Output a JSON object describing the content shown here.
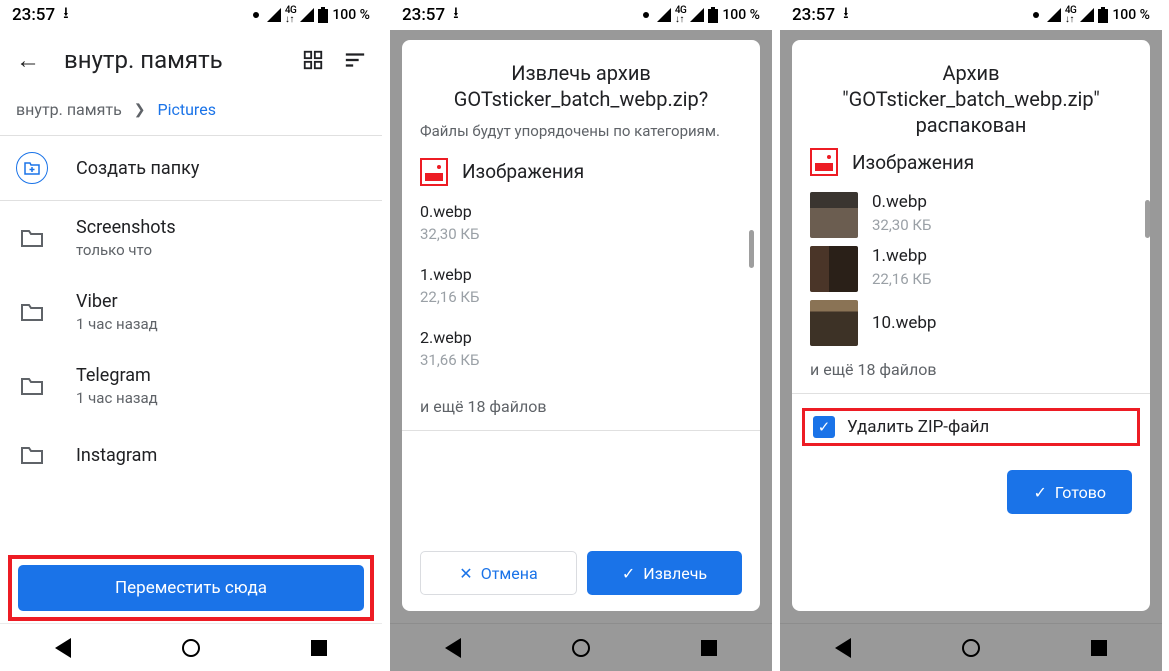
{
  "status": {
    "time": "23:57",
    "net": "4G",
    "battery": "100 %"
  },
  "screen1": {
    "title": "внутр. память",
    "breadcrumb_root": "внутр. память",
    "breadcrumb_current": "Pictures",
    "new_folder": "Создать папку",
    "items": [
      {
        "title": "Screenshots",
        "sub": "только что"
      },
      {
        "title": "Viber",
        "sub": "1 час назад"
      },
      {
        "title": "Telegram",
        "sub": "1 час назад"
      },
      {
        "title": "Instagram",
        "sub": ""
      }
    ],
    "move_button": "Переместить сюда"
  },
  "screen2": {
    "title_line1": "Извлечь архив",
    "title_line2": "GOTsticker_batch_webp.zip?",
    "subtitle": "Файлы будут упорядочены по категориям.",
    "category": "Изображения",
    "files": [
      {
        "name": "0.webp",
        "size": "32,30 КБ"
      },
      {
        "name": "1.webp",
        "size": "22,16 КБ"
      },
      {
        "name": "2.webp",
        "size": "31,66 КБ"
      }
    ],
    "more": "и ещё 18 файлов",
    "cancel": "Отмена",
    "extract": "Извлечь"
  },
  "screen3": {
    "title_line1": "Архив",
    "title_line2": "\"GOTsticker_batch_webp.zip\"",
    "title_line3": "распакован",
    "category": "Изображения",
    "files": [
      {
        "name": "0.webp",
        "size": "32,30 КБ"
      },
      {
        "name": "1.webp",
        "size": "22,16 КБ"
      },
      {
        "name": "10.webp",
        "size": ""
      }
    ],
    "more": "и ещё 18 файлов",
    "delete_zip": "Удалить ZIP-файл",
    "done": "Готово"
  }
}
